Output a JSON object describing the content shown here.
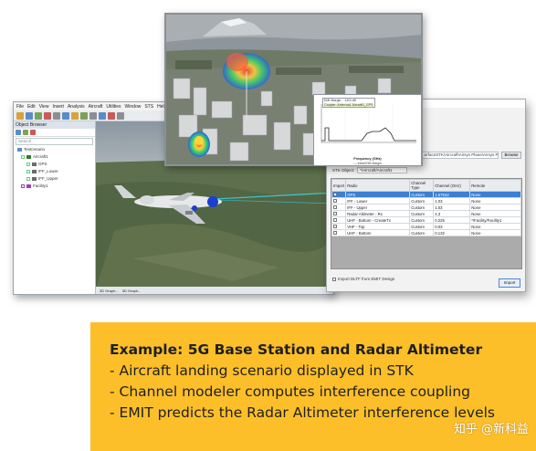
{
  "stk": {
    "menu": [
      "File",
      "Edit",
      "View",
      "Insert",
      "Analysis",
      "Aircraft",
      "Utilities",
      "Window",
      "STS",
      "Help"
    ],
    "object_browser_title": "Object Browser",
    "search_placeholder": "Search",
    "tree": [
      {
        "label": "Testcenario",
        "color": "#5b8cc8"
      },
      {
        "label": "Aircraft1",
        "color": "#2d7d2d"
      },
      {
        "label": "GPS",
        "color": "#6a6a6a"
      },
      {
        "label": "IFF_Lower",
        "color": "#6a6a6a"
      },
      {
        "label": "IFF_Upper",
        "color": "#6a6a6a"
      },
      {
        "label": "Facility1",
        "color": "#a33cb0"
      }
    ],
    "tabs": [
      "3D Graph...",
      "3D Graph..."
    ]
  },
  "dialog": {
    "file_path": "...erfaceSTK\\Aircraft\\Airsys Plane\\Airsys Plane.aedt",
    "browse_label": "Browse",
    "stk_object_label": "STK Object:",
    "stk_object_value": "*/Aircraft/Aircraft1",
    "columns": [
      "Import",
      "Radio",
      "Channel Type",
      "Channel (GHz)",
      "Remote"
    ],
    "rows": [
      {
        "radio": "GPS",
        "channel_type": "Custom",
        "channel": "1.57542",
        "remote": "None",
        "selected": true
      },
      {
        "radio": "IFF - Lower",
        "channel_type": "Custom",
        "channel": "1.03",
        "remote": "None",
        "selected": false
      },
      {
        "radio": "IFF - Upper",
        "channel_type": "Custom",
        "channel": "1.03",
        "remote": "None",
        "selected": false
      },
      {
        "radio": "Radar Altimeter - Rx",
        "channel_type": "Custom",
        "channel": "4.3",
        "remote": "None",
        "selected": false
      },
      {
        "radio": "UHF - Bottom - CreateTx",
        "channel_type": "Custom",
        "channel": "0.225",
        "remote": "*/Facility/Facility1",
        "selected": false
      },
      {
        "radio": "VHF - Top",
        "channel_type": "Custom",
        "channel": "0.03",
        "remote": "None",
        "selected": false
      },
      {
        "radio": "UHF - Bottom",
        "channel_type": "Custom",
        "channel": "0.132",
        "remote": "None",
        "selected": false
      }
    ],
    "import_checkbox_label": "Import DLTF from EMIT Design",
    "import_button": "Import"
  },
  "plot": {
    "tag_line1": "EMI Margin : -18.5 dB",
    "tag_line2": "Coupler: Antenna1 Aircraft1_GPS",
    "xlabel": "Frequency (GHz)",
    "legend": "— Initial EMI Margin"
  },
  "panel": {
    "heading": "Example: 5G Base Station and Radar Altimeter",
    "bullets": [
      "- Aircraft landing scenario displayed in STK",
      "- Channel modeler computes interference coupling",
      "- EMIT predicts the Radar Altimeter interference levels"
    ],
    "background": "#fcbf2a"
  },
  "watermark": "知乎 @新科益"
}
